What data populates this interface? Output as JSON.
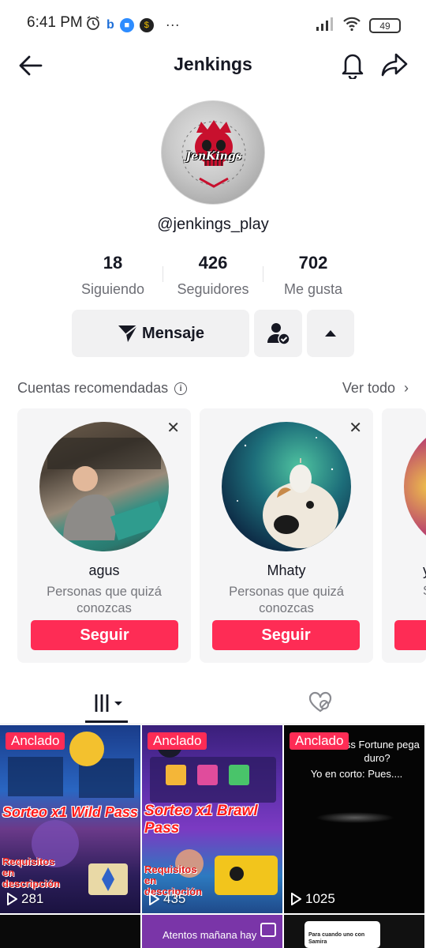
{
  "status_bar": {
    "time": "6:41 PM",
    "battery": "49",
    "dots": "···"
  },
  "header": {
    "title": "Jenkings"
  },
  "profile": {
    "username": "@jenkings_play",
    "avatar_text": "JenKings",
    "stats": [
      {
        "value": "18",
        "label": "Siguiendo"
      },
      {
        "value": "426",
        "label": "Seguidores"
      },
      {
        "value": "702",
        "label": "Me gusta"
      }
    ]
  },
  "actions": {
    "message_label": "Mensaje"
  },
  "recommended": {
    "title": "Cuentas recomendadas",
    "see_all": "Ver todo",
    "cards": [
      {
        "name": "agus",
        "subtitle": "Personas que quizá conozcas",
        "follow": "Seguir"
      },
      {
        "name": "Mhaty",
        "subtitle": "Personas que quizá conozcas",
        "follow": "Seguir"
      }
    ],
    "partial_card": {
      "name": "y",
      "subtitle": "S"
    }
  },
  "videos": [
    {
      "badge": "Anclado",
      "views": "281",
      "caption": "Sorteo x1 Wild Pass",
      "sub": "Requisitos en descripción"
    },
    {
      "badge": "Anclado",
      "views": "435",
      "caption": "Sorteo x1 Brawl Pass",
      "sub": "Requisitos en descripción"
    },
    {
      "badge": "Anclado",
      "views": "1025",
      "caption": "Miss Fortune pega duro?",
      "sub": "Yo en corto: Pues...."
    },
    {
      "caption": "Atentos mañana hay"
    },
    {
      "caption": "Para cuando uno con Samira"
    }
  ],
  "colors": {
    "accent": "#fe2c55",
    "text": "#161823",
    "muted": "#6d6e75",
    "button_bg": "#f1f1f2"
  }
}
